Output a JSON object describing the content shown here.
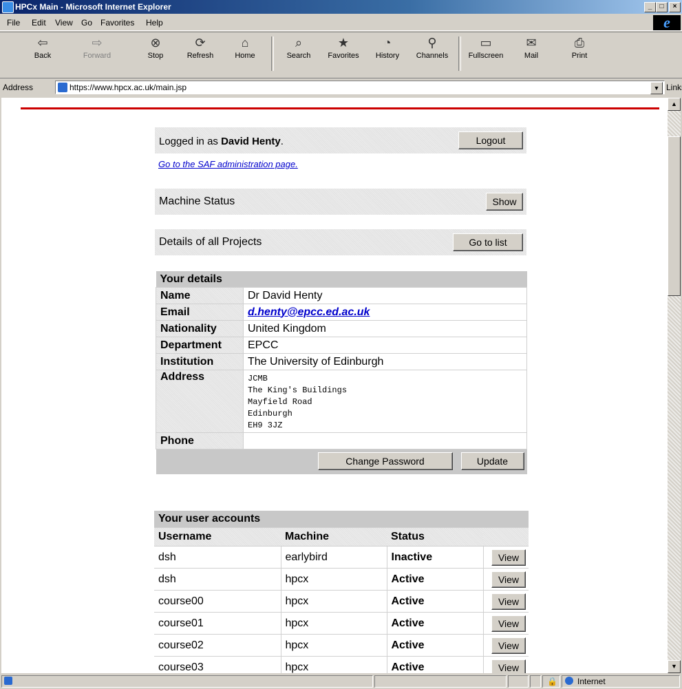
{
  "window": {
    "title": "HPCx Main - Microsoft Internet Explorer"
  },
  "menu": [
    "File",
    "Edit",
    "View",
    "Go",
    "Favorites",
    "Help"
  ],
  "toolbar": {
    "back": "Back",
    "forward": "Forward",
    "stop": "Stop",
    "refresh": "Refresh",
    "home": "Home",
    "search": "Search",
    "favorites": "Favorites",
    "history": "History",
    "channels": "Channels",
    "fullscreen": "Fullscreen",
    "mail": "Mail",
    "print": "Print"
  },
  "address": {
    "label": "Address",
    "url": "https://www.hpcx.ac.uk/main.jsp",
    "links": "Links"
  },
  "login": {
    "prefix": "Logged in as ",
    "user": "David Henty",
    "suffix": ".",
    "logout": "Logout"
  },
  "saf_link": "Go to the SAF administration page.",
  "machine_status": {
    "label": "Machine Status",
    "button": "Show"
  },
  "projects": {
    "label": "Details of all Projects",
    "button": "Go to list"
  },
  "details": {
    "heading": "Your details",
    "name_label": "Name",
    "name": "Dr David Henty",
    "email_label": "Email",
    "email": "d.henty@epcc.ed.ac.uk",
    "nationality_label": "Nationality",
    "nationality": "United Kingdom",
    "department_label": "Department",
    "department": "EPCC",
    "institution_label": "Institution",
    "institution": "The University of Edinburgh",
    "address_label": "Address",
    "address": "JCMB\nThe King's Buildings\nMayfield Road\nEdinburgh\nEH9 3JZ",
    "phone_label": "Phone",
    "phone": "",
    "change_password": "Change Password",
    "update": "Update"
  },
  "accounts": {
    "heading": "Your user accounts",
    "columns": [
      "Username",
      "Machine",
      "Status"
    ],
    "view": "View",
    "rows": [
      {
        "user": "dsh",
        "machine": "earlybird",
        "status": "Inactive"
      },
      {
        "user": "dsh",
        "machine": "hpcx",
        "status": "Active"
      },
      {
        "user": "course00",
        "machine": "hpcx",
        "status": "Active"
      },
      {
        "user": "course01",
        "machine": "hpcx",
        "status": "Active"
      },
      {
        "user": "course02",
        "machine": "hpcx",
        "status": "Active"
      },
      {
        "user": "course03",
        "machine": "hpcx",
        "status": "Active"
      }
    ]
  },
  "statusbar": {
    "zone": "Internet"
  }
}
